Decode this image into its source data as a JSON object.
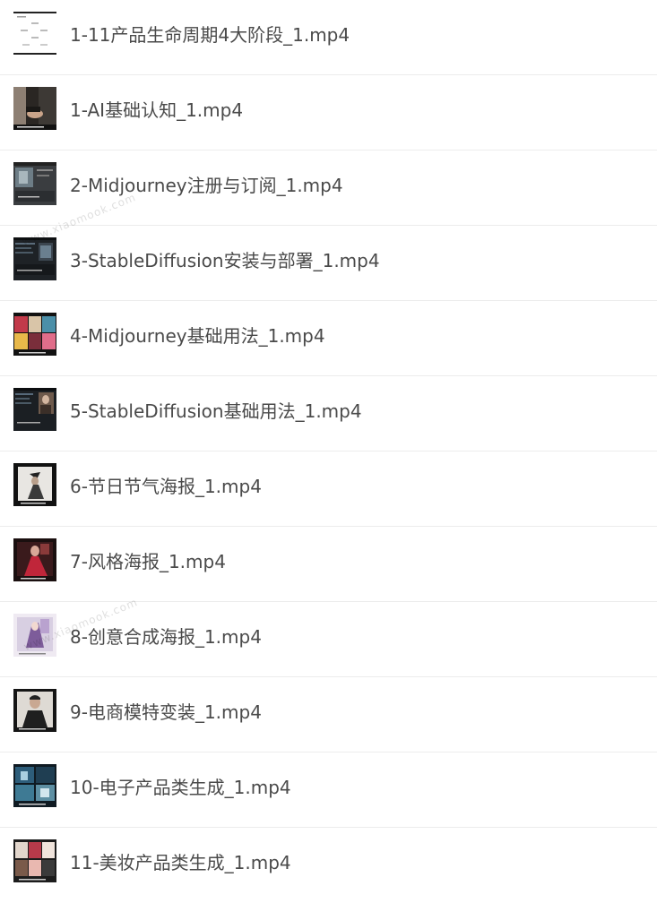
{
  "files": [
    {
      "name": "1-11产品生命周期4大阶段_1.mp4",
      "thumb_icon": "diagram-slide-thumbnail"
    },
    {
      "name": "1-AI基础认知_1.mp4",
      "thumb_icon": "person-hands-thumbnail"
    },
    {
      "name": "2-Midjourney注册与订阅_1.mp4",
      "thumb_icon": "app-screen-thumbnail"
    },
    {
      "name": "3-StableDiffusion安装与部署_1.mp4",
      "thumb_icon": "dark-ui-thumbnail"
    },
    {
      "name": "4-Midjourney基础用法_1.mp4",
      "thumb_icon": "art-gallery-thumbnail"
    },
    {
      "name": "5-StableDiffusion基础用法_1.mp4",
      "thumb_icon": "dark-ui-portrait-thumbnail"
    },
    {
      "name": "6-节日节气海报_1.mp4",
      "thumb_icon": "figure-poster-thumbnail"
    },
    {
      "name": "7-风格海报_1.mp4",
      "thumb_icon": "red-dress-poster-thumbnail"
    },
    {
      "name": "8-创意合成海报_1.mp4",
      "thumb_icon": "purple-poster-thumbnail"
    },
    {
      "name": "9-电商模特变装_1.mp4",
      "thumb_icon": "model-portrait-thumbnail"
    },
    {
      "name": "10-电子产品类生成_1.mp4",
      "thumb_icon": "product-grid-thumbnail"
    },
    {
      "name": "11-美妆产品类生成_1.mp4",
      "thumb_icon": "cosmetics-grid-thumbnail"
    }
  ],
  "watermark": {
    "text": "www.xiaomook.com"
  }
}
